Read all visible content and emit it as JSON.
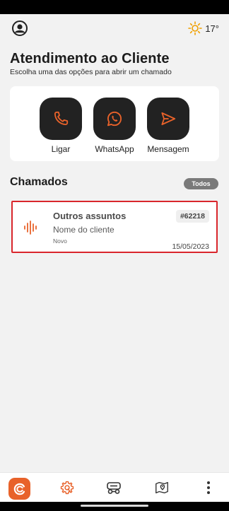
{
  "header": {
    "temperature": "17°"
  },
  "page": {
    "title": "Atendimento ao Cliente",
    "subtitle": "Escolha uma das opções para abrir um chamado"
  },
  "actions": [
    {
      "label": "Ligar",
      "icon": "phone-icon"
    },
    {
      "label": "WhatsApp",
      "icon": "whatsapp-icon"
    },
    {
      "label": "Mensagem",
      "icon": "send-icon"
    }
  ],
  "tickets_section": {
    "title": "Chamados",
    "filter_label": "Todos"
  },
  "tickets": [
    {
      "title": "Outros assuntos",
      "id": "#62218",
      "client": "Nome do cliente",
      "status": "Novo",
      "date": "15/05/2023"
    }
  ],
  "bottom_nav": [
    {
      "icon": "app-logo-icon",
      "active": false
    },
    {
      "icon": "settings-gear-icon",
      "active": true
    },
    {
      "icon": "vehicle-icon",
      "active": false
    },
    {
      "icon": "map-pin-icon",
      "active": false
    },
    {
      "icon": "more-vertical-icon",
      "active": false
    }
  ],
  "colors": {
    "accent": "#e8622a",
    "dark": "#222222",
    "highlight_border": "#d9262c",
    "background": "#f2f2f2"
  }
}
